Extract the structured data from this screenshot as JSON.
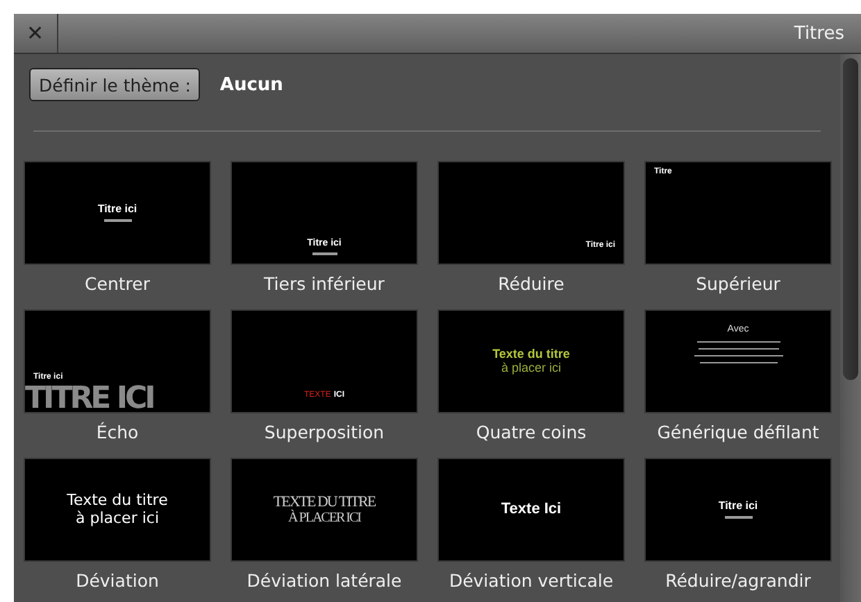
{
  "window": {
    "close": "✕",
    "title": "Titres"
  },
  "theme": {
    "button": "Définir le thème :",
    "value": "Aucun"
  },
  "titles": [
    {
      "label": "Centrer",
      "kind": "center",
      "preview": [
        "Titre ici"
      ]
    },
    {
      "label": "Tiers inférieur",
      "kind": "lower",
      "preview": [
        "Titre ici"
      ]
    },
    {
      "label": "Réduire",
      "kind": "corner",
      "preview": [
        "Titre ici"
      ]
    },
    {
      "label": "Supérieur",
      "kind": "top",
      "preview": [
        "Titre"
      ]
    },
    {
      "label": "Écho",
      "kind": "echo",
      "preview": [
        "Titre ici",
        "TITRE ICI"
      ]
    },
    {
      "label": "Superposition",
      "kind": "overlay",
      "preview": [
        "TEXTE",
        "ICI"
      ]
    },
    {
      "label": "Quatre coins",
      "kind": "four",
      "preview": [
        "Texte du titre",
        "à placer ici"
      ]
    },
    {
      "label": "Générique défilant",
      "kind": "credits",
      "preview": [
        "Avec"
      ]
    },
    {
      "label": "Déviation",
      "kind": "drift",
      "preview": [
        "Texte du titre",
        "à placer ici"
      ]
    },
    {
      "label": "Déviation latérale",
      "kind": "serif",
      "preview": [
        "TEXTE DU TITRE",
        "À PLACER ICI"
      ]
    },
    {
      "label": "Déviation verticale",
      "kind": "bold",
      "preview": [
        "Texte Ici"
      ]
    },
    {
      "label": "Réduire/agrandir",
      "kind": "center",
      "preview": [
        "Titre ici"
      ]
    }
  ]
}
